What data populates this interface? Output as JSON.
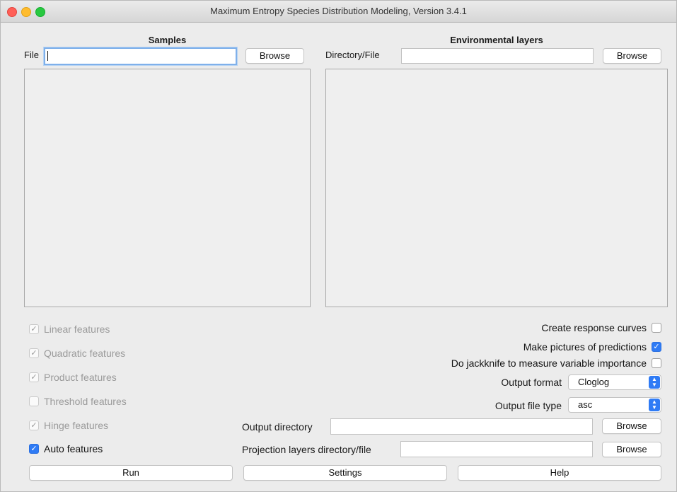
{
  "window": {
    "title": "Maximum Entropy Species Distribution Modeling, Version 3.4.1"
  },
  "samples": {
    "heading": "Samples",
    "file_label": "File",
    "file_value": "",
    "browse_label": "Browse"
  },
  "env": {
    "heading": "Environmental layers",
    "dir_label": "Directory/File",
    "dir_value": "",
    "browse_label": "Browse"
  },
  "features": [
    {
      "label": "Linear features",
      "checked": true,
      "enabled": false
    },
    {
      "label": "Quadratic features",
      "checked": true,
      "enabled": false
    },
    {
      "label": "Product features",
      "checked": true,
      "enabled": false
    },
    {
      "label": "Threshold features",
      "checked": false,
      "enabled": false
    },
    {
      "label": "Hinge features",
      "checked": true,
      "enabled": false
    },
    {
      "label": "Auto features",
      "checked": true,
      "enabled": true
    }
  ],
  "options": {
    "response_curves": {
      "label": "Create response curves",
      "checked": false
    },
    "pictures": {
      "label": "Make pictures of predictions",
      "checked": true
    },
    "jackknife": {
      "label": "Do jackknife to measure variable importance",
      "checked": false
    },
    "output_format": {
      "label": "Output format",
      "value": "Cloglog"
    },
    "output_file_type": {
      "label": "Output file type",
      "value": "asc"
    }
  },
  "output_dir": {
    "label": "Output directory",
    "value": "",
    "browse_label": "Browse"
  },
  "projection": {
    "label": "Projection layers directory/file",
    "value": "",
    "browse_label": "Browse"
  },
  "actions": {
    "run": "Run",
    "settings": "Settings",
    "help": "Help"
  },
  "colors": {
    "accent": "#2f7bf5",
    "focus_ring": "#7fb0ea",
    "background": "#ececec",
    "disabled_text": "#9a9a9a"
  }
}
